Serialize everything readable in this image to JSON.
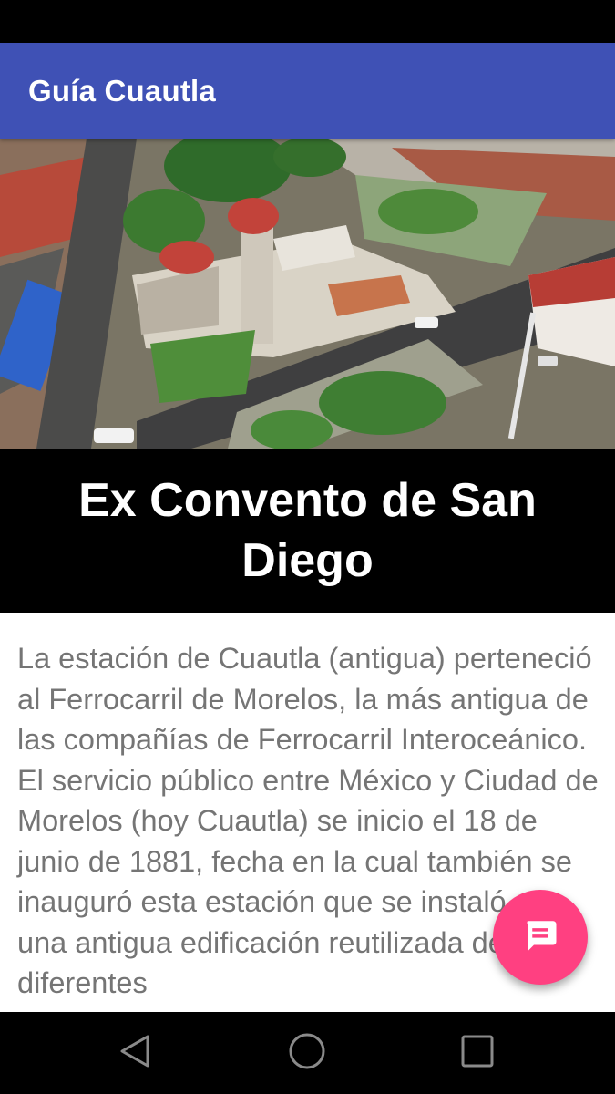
{
  "app_bar": {
    "title": "Guía Cuautla",
    "color": "#3f51b5"
  },
  "hero_image": {
    "alt": "Ex Convento de San Diego"
  },
  "place": {
    "title": "Ex Convento de San Diego",
    "description": "La estación de Cuautla (antigua) perteneció al Ferrocarril de Morelos, la más antigua de las compañías de Ferrocarril Interoceánico.  El servicio público entre México y Ciudad de Morelos (hoy Cuautla) se inicio el 18 de junio de 1881, fecha en la cual también se inauguró esta estación que se instaló en una antigua edificación reutilizada de diferentes"
  },
  "fab": {
    "icon": "message-icon",
    "color": "#ff4081"
  },
  "nav": {
    "back_icon": "back-triangle-icon",
    "home_icon": "home-circle-icon",
    "recents_icon": "recents-square-icon"
  }
}
